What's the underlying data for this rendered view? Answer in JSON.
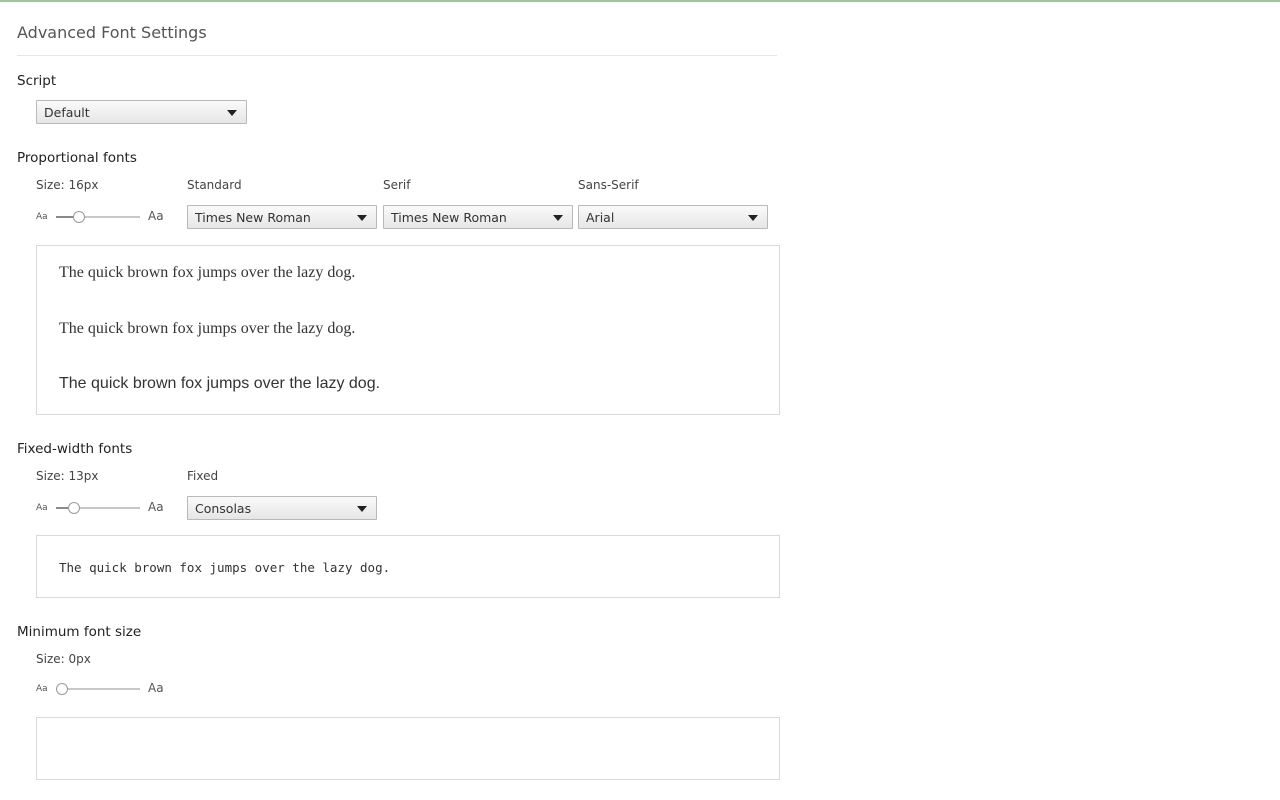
{
  "page": {
    "title": "Advanced Font Settings"
  },
  "script": {
    "label": "Script",
    "selected": "Default"
  },
  "proportional": {
    "label": "Proportional fonts",
    "size_label": "Size: 16px",
    "slider_level_fraction": 0.24,
    "aa_small": "Aa",
    "aa_big": "Aa",
    "standard": {
      "label": "Standard",
      "selected": "Times New Roman"
    },
    "serif": {
      "label": "Serif",
      "selected": "Times New Roman"
    },
    "sans_serif": {
      "label": "Sans-Serif",
      "selected": "Arial"
    },
    "preview": {
      "standard": "The quick brown fox jumps over the lazy dog.",
      "serif": "The quick brown fox jumps over the lazy dog.",
      "sans_serif": "The quick brown fox jumps over the lazy dog."
    }
  },
  "fixed": {
    "label": "Fixed-width fonts",
    "size_label": "Size: 13px",
    "slider_level_fraction": 0.17,
    "aa_small": "Aa",
    "aa_big": "Aa",
    "fixed": {
      "label": "Fixed",
      "selected": "Consolas"
    },
    "preview": "The quick brown fox jumps over the lazy dog."
  },
  "minimum": {
    "label": "Minimum font size",
    "size_label": "Size: 0px",
    "slider_level_fraction": 0.0,
    "aa_small": "Aa",
    "aa_big": "Aa",
    "preview": ""
  }
}
